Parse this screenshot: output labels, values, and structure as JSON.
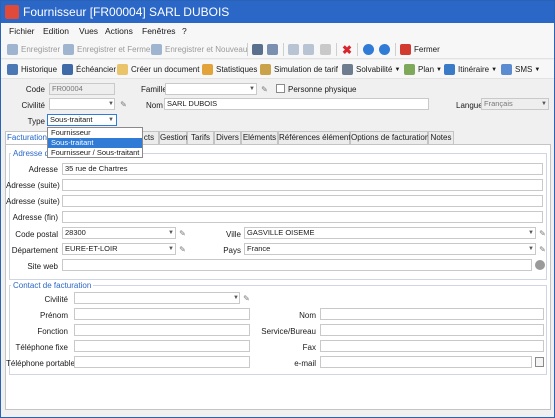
{
  "window": {
    "title": "Fournisseur [FR00004] SARL DUBOIS"
  },
  "menu": [
    "Fichier",
    "Edition",
    "Vues",
    "Actions",
    "Fenêtres",
    "?"
  ],
  "toolbar1": {
    "save": "Enregistrer",
    "save_close": "Enregistrer et Fermer",
    "save_new": "Enregistrer et Nouveau",
    "close": "Fermer"
  },
  "toolbar2": {
    "historique": "Historique",
    "echeancier": "Échéancier",
    "creer_document": "Créer un document",
    "statistiques": "Statistiques",
    "simulation": "Simulation de tarif",
    "solvabilite": "Solvabilité",
    "plan": "Plan",
    "itineraire": "Itinéraire",
    "sms": "SMS"
  },
  "header": {
    "code_label": "Code",
    "code_value": "FR00004",
    "famille_label": "Famille",
    "famille_value": "",
    "personne_physique_label": "Personne physique",
    "civilite_label": "Civilité",
    "civilite_value": "",
    "nom_label": "Nom",
    "nom_value": "SARL DUBOIS",
    "langue_label": "Langue",
    "langue_value": "Français",
    "type_label": "Type",
    "type_value": "Sous-traitant"
  },
  "type_options": [
    "Fournisseur",
    "Sous-traitant",
    "Fournisseur / Sous-traitant"
  ],
  "type_selected_index": 1,
  "tabs": [
    "Facturation",
    "cts",
    "Gestion",
    "Tarifs",
    "Divers",
    "Eléments",
    "Références élément",
    "Options de facturation",
    "Notes"
  ],
  "adresse": {
    "title": "Adresse de",
    "adresse_label": "Adresse",
    "adresse_value": "35 rue de Chartres",
    "suite1_label": "Adresse (suite)",
    "suite2_label": "Adresse (suite)",
    "fin_label": "Adresse (fin)",
    "cp_label": "Code postal",
    "cp_value": "28300",
    "ville_label": "Ville",
    "ville_value": "GASVILLE OISEME",
    "dept_label": "Département",
    "dept_value": "EURE-ET-LOIR",
    "pays_label": "Pays",
    "pays_value": "France",
    "web_label": "Site web",
    "web_value": ""
  },
  "contact": {
    "title": "Contact de facturation",
    "civilite_label": "Civilité",
    "prenom_label": "Prénom",
    "nom_label": "Nom",
    "fonction_label": "Fonction",
    "service_label": "Service/Bureau",
    "tel_label": "Téléphone fixe",
    "fax_label": "Fax",
    "portable_label": "Téléphone portable",
    "email_label": "e-mail"
  },
  "colors": {
    "title_bar": "#2b67c6",
    "accent": "#1f63c9",
    "selection": "#2f7bd6"
  }
}
